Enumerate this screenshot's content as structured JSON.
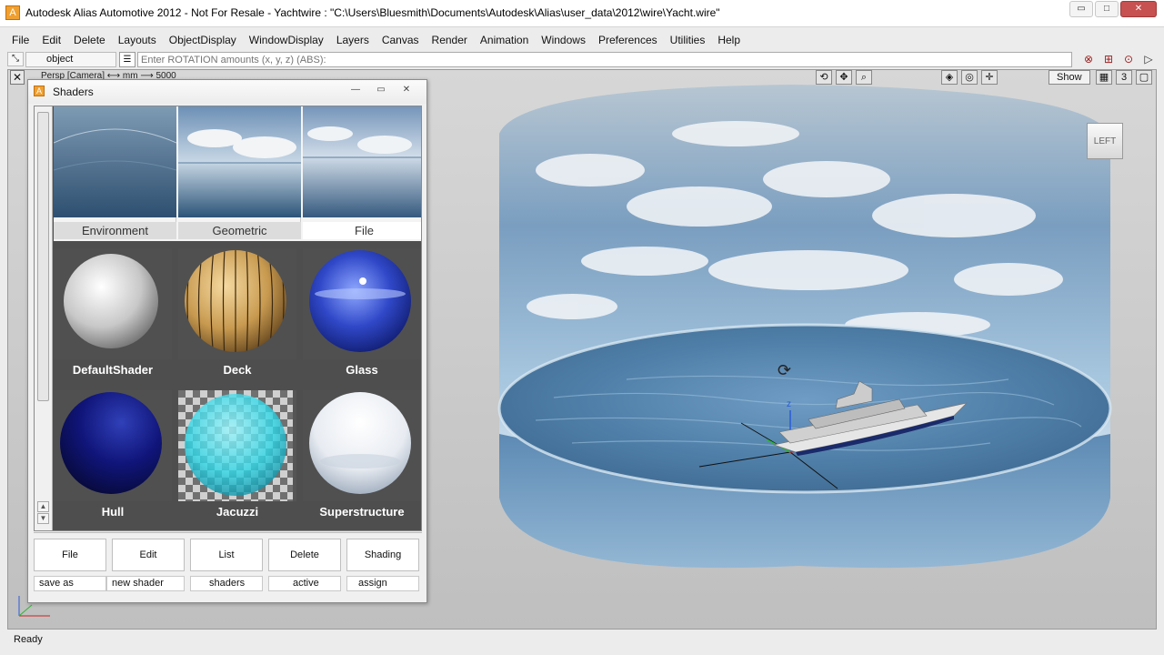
{
  "window": {
    "title": "Autodesk Alias Automotive 2012 - Not For Resale - Yachtwire : \"C:\\Users\\Bluesmith\\Documents\\Autodesk\\Alias\\user_data\\2012\\wire\\Yacht.wire\"",
    "minimize": "▭",
    "maximize": "□",
    "close": "✕"
  },
  "menu": [
    "File",
    "Edit",
    "Delete",
    "Layouts",
    "ObjectDisplay",
    "WindowDisplay",
    "Layers",
    "Canvas",
    "Render",
    "Animation",
    "Windows",
    "Preferences",
    "Utilities",
    "Help"
  ],
  "command": {
    "mode": "object",
    "placeholder": "Enter ROTATION amounts (x, y, z) (ABS):"
  },
  "viewport": {
    "close": "✕",
    "label": "Persp [Camera] ⟷ mm  ⟶ 5000",
    "show": "Show",
    "view_num": "3",
    "cube_face": "LEFT",
    "axis_z": "z"
  },
  "shaders": {
    "title": "Shaders",
    "minimize": "—",
    "restore": "▭",
    "close": "✕",
    "top_tiles": [
      "Environment",
      "Geometric",
      "File"
    ],
    "tiles": [
      "DefaultShader",
      "Deck",
      "Glass",
      "Hull",
      "Jacuzzi",
      "Superstructure"
    ],
    "actions": [
      "File",
      "Edit",
      "List",
      "Delete",
      "Shading"
    ],
    "subs": [
      "save as",
      "new shader",
      "shaders",
      "active",
      "assign"
    ]
  },
  "status": "Ready"
}
